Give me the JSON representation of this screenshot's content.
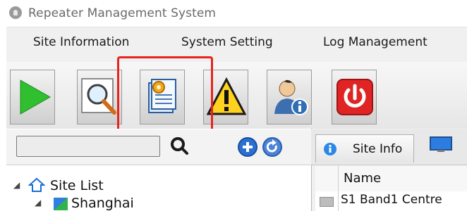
{
  "window": {
    "title": "Repeater Management System",
    "app_icon": "user-circle-icon"
  },
  "menu": {
    "items": [
      {
        "label": "Site Information"
      },
      {
        "label": "System Setting"
      },
      {
        "label": "Log Management"
      }
    ]
  },
  "toolbar": {
    "buttons": [
      {
        "icon": "play-icon"
      },
      {
        "icon": "magnifier-icon"
      },
      {
        "icon": "settings-document-icon"
      },
      {
        "icon": "warning-icon"
      },
      {
        "icon": "user-info-icon"
      },
      {
        "icon": "power-icon"
      }
    ],
    "highlight_color": "#e8231d"
  },
  "left_panel": {
    "search": {
      "value": "",
      "icon": "search-icon"
    },
    "add_icon": "plus-circle-icon",
    "refresh_icon": "refresh-icon",
    "tree": {
      "root": {
        "label": "Site List",
        "icon": "home-icon"
      },
      "children": [
        {
          "label": "Shanghai",
          "icon": "site-icon"
        }
      ]
    }
  },
  "right_panel": {
    "tabs": [
      {
        "label": "Site Info",
        "icon": "info-icon"
      }
    ],
    "grid": {
      "columns": [
        "Name"
      ],
      "rows": [
        {
          "name": "S1 Band1 Centre"
        }
      ]
    }
  }
}
